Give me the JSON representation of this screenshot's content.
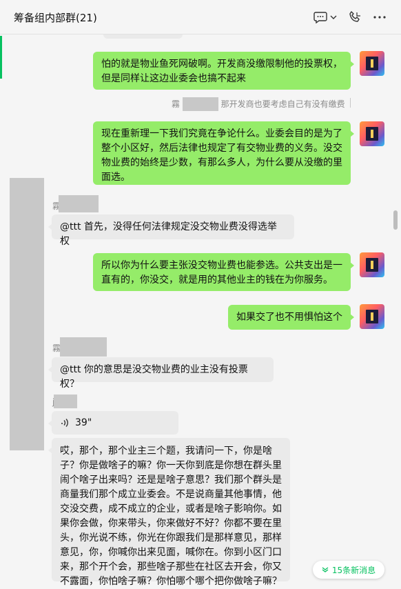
{
  "window": {
    "title": "筹备组内部群(21)",
    "icons": [
      "chat-options-icon",
      "chevron-down-icon",
      "phone-icon",
      "more-icon"
    ]
  },
  "messages": [
    {
      "side": "right",
      "text_lines": [
        "怕的就是物业鱼死网破啊。开发商没缴限制他的投票权，",
        "但是同样让这边业委会也搞不起来"
      ]
    },
    {
      "quote_prefix": "霧",
      "quote_text": "那开发商也要考虑自己有没有缴费"
    },
    {
      "side": "right",
      "text_lines": [
        "现在重新理一下我们究竟在争论什么。业委会目的是为了",
        "整个小区好，然后法律也规定了有交物业费的义务。没交",
        "物业费的始终是少数，有那么多人，为什么要从没缴的里",
        "面选。"
      ]
    },
    {
      "sender_prefix": "霧",
      "side": "left",
      "text_lines": [
        "@ttt 首先，没得任何法律规定没交物业费没得选举权"
      ]
    },
    {
      "side": "right",
      "text_lines": [
        "所以你为什么要主张没交物业费也能参选。公共支出是一",
        "直有的，你没交，就是用的其他业主的钱在为你服务。"
      ]
    },
    {
      "side": "right",
      "text_lines": [
        "如果交了也不用惧怕这个"
      ]
    },
    {
      "sender_prefix": "霧",
      "side": "left",
      "text_lines": [
        "@ttt 你的意思是没交物业费的业主没有投票权？"
      ]
    },
    {
      "sender_prefix": "j",
      "side": "left",
      "voice_duration": "39\""
    },
    {
      "side": "left",
      "text_lines": [
        "哎，那个，那个业主三个题，我请问一下，你是啥",
        "子？你是做啥子的嘛？你一天你到底是你想在群头里",
        "闹个啥子出来吗？还是是啥子意思？我们那个群头是",
        "商量我们那个成立业委会。不是说商量其他事情，他",
        "交没交费，成不成立的企业，或者是啥子影响你。如",
        "果你会做，你来带头，你来做好不好？你都不要在里",
        "头，你光说不练，你光在你跟我们是那样意见，那样",
        "意见，你，你喊你出来见面，喊你在。你到小区门口",
        "来，那个开个会，那些啥子那些在社区去开会，你又",
        "不露面，你怕啥子嘛？你怕哪个哪个把你做啥子嘛？"
      ]
    }
  ],
  "new_messages_label": "15条新消息",
  "colors": {
    "green_bubble": "#95ec69",
    "grey_bubble": "#eaeaea",
    "accent": "#07c160"
  }
}
